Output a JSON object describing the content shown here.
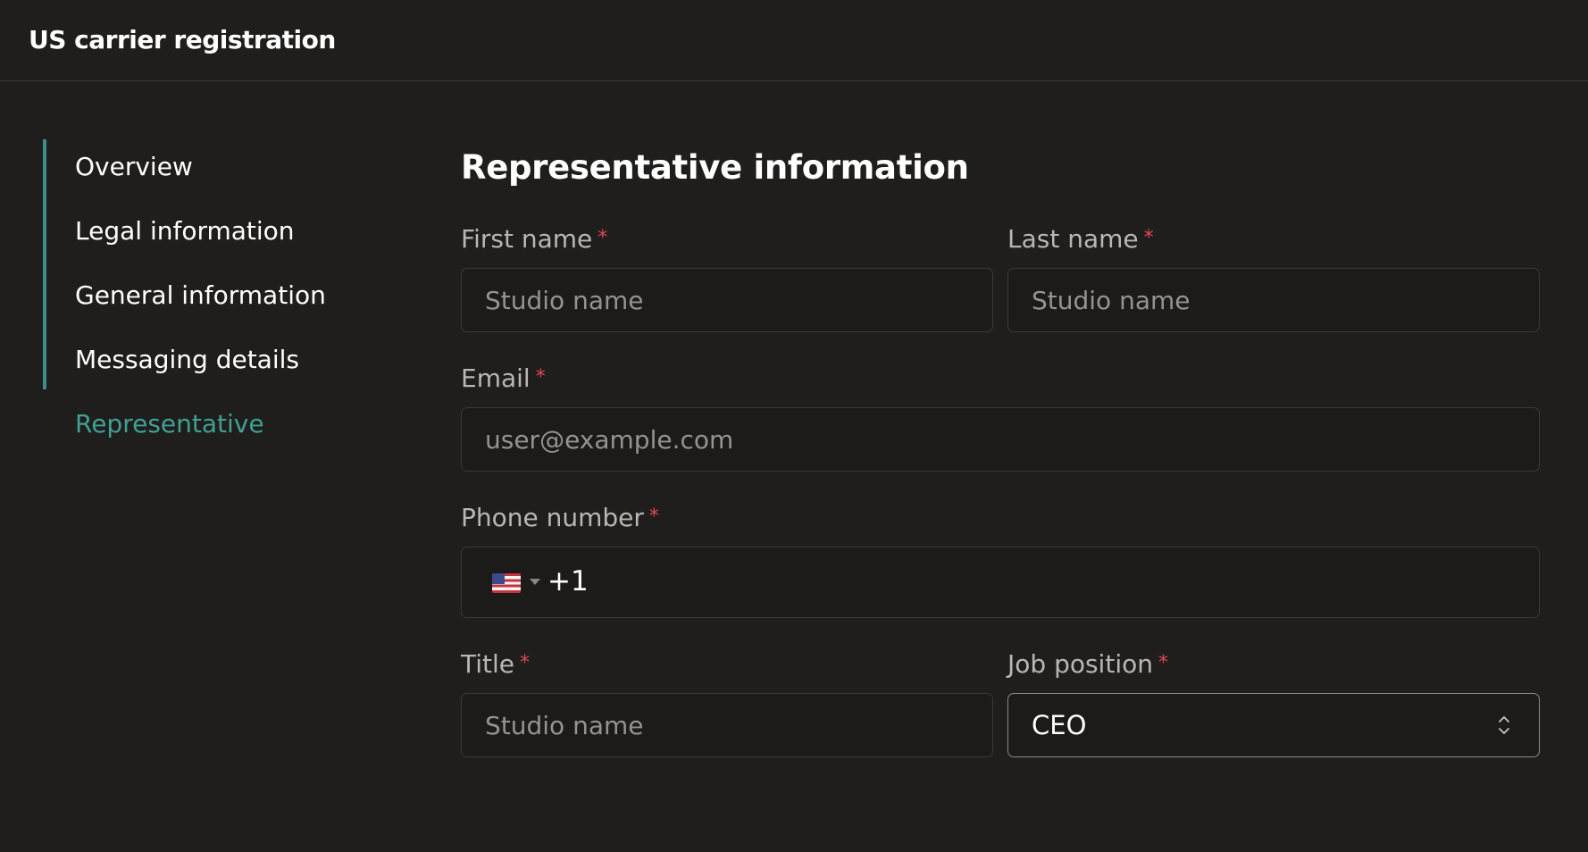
{
  "header": {
    "title": "US carrier registration"
  },
  "sidebar": {
    "items": [
      {
        "label": "Overview"
      },
      {
        "label": "Legal information"
      },
      {
        "label": "General information"
      },
      {
        "label": "Messaging details"
      },
      {
        "label": "Representative",
        "active": true
      }
    ]
  },
  "form": {
    "title": "Representative information",
    "required_marker": "*",
    "first_name": {
      "label": "First name",
      "value": "",
      "placeholder": "Studio name"
    },
    "last_name": {
      "label": "Last name",
      "value": "",
      "placeholder": "Studio name"
    },
    "email": {
      "label": "Email",
      "value": "",
      "placeholder": "user@example.com"
    },
    "phone": {
      "label": "Phone number",
      "country_icon": "us-flag-icon",
      "dial_code": "+1",
      "value": ""
    },
    "title_field": {
      "label": "Title",
      "value": "",
      "placeholder": "Studio name"
    },
    "job_position": {
      "label": "Job position",
      "value": "CEO"
    }
  },
  "colors": {
    "background": "#1f1e1c",
    "accent": "#3fa093",
    "required": "#e0465a",
    "label": "#b9b7b2"
  }
}
